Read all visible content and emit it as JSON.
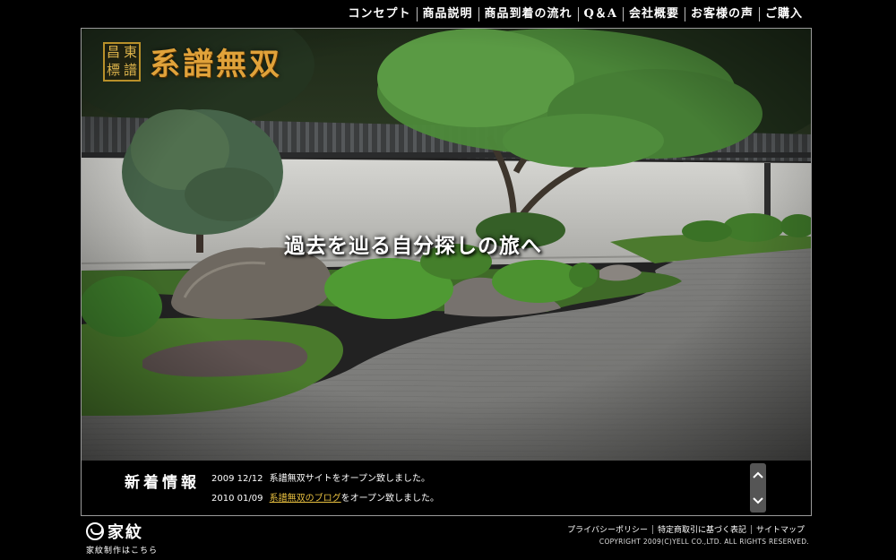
{
  "nav": {
    "items": [
      {
        "label": "コンセプト"
      },
      {
        "label": "商品説明"
      },
      {
        "label": "商品到着の流れ"
      },
      {
        "label": "Q＆A"
      },
      {
        "label": "会社概要"
      },
      {
        "label": "お客様の声"
      },
      {
        "label": "ご購入"
      }
    ]
  },
  "logo": {
    "seal_chars": [
      "東",
      "譜",
      "標",
      "昌"
    ],
    "text": "系譜無双"
  },
  "hero": {
    "tagline": "過去を辿る自分探しの旅へ"
  },
  "news": {
    "title": "新着情報",
    "items": [
      {
        "date": "2009 12/12",
        "pre": "",
        "link": "",
        "text": "系譜無双サイトをオープン致しました。"
      },
      {
        "date": "2010 01/09",
        "pre": "",
        "link": "系譜無双のブログ",
        "text": "をオープン致しました。"
      }
    ]
  },
  "kamon": {
    "title": "家紋",
    "subtitle": "家紋制作はこちら"
  },
  "footer": {
    "links": [
      {
        "label": "プライバシーポリシー"
      },
      {
        "label": "特定商取引に基づく表記"
      },
      {
        "label": "サイトマップ"
      }
    ],
    "copyright": "COPYRIGHT 2009(C)YELL CO.,LTD. ALL RIGHTS RESERVED."
  },
  "colors": {
    "logo_gold": "#e0a23a",
    "news_link": "#e8c040",
    "background": "#000000"
  },
  "icons": {
    "scroll_up": "chevron-up-icon",
    "scroll_down": "chevron-down-icon",
    "kamon": "kamon-crest-icon"
  }
}
